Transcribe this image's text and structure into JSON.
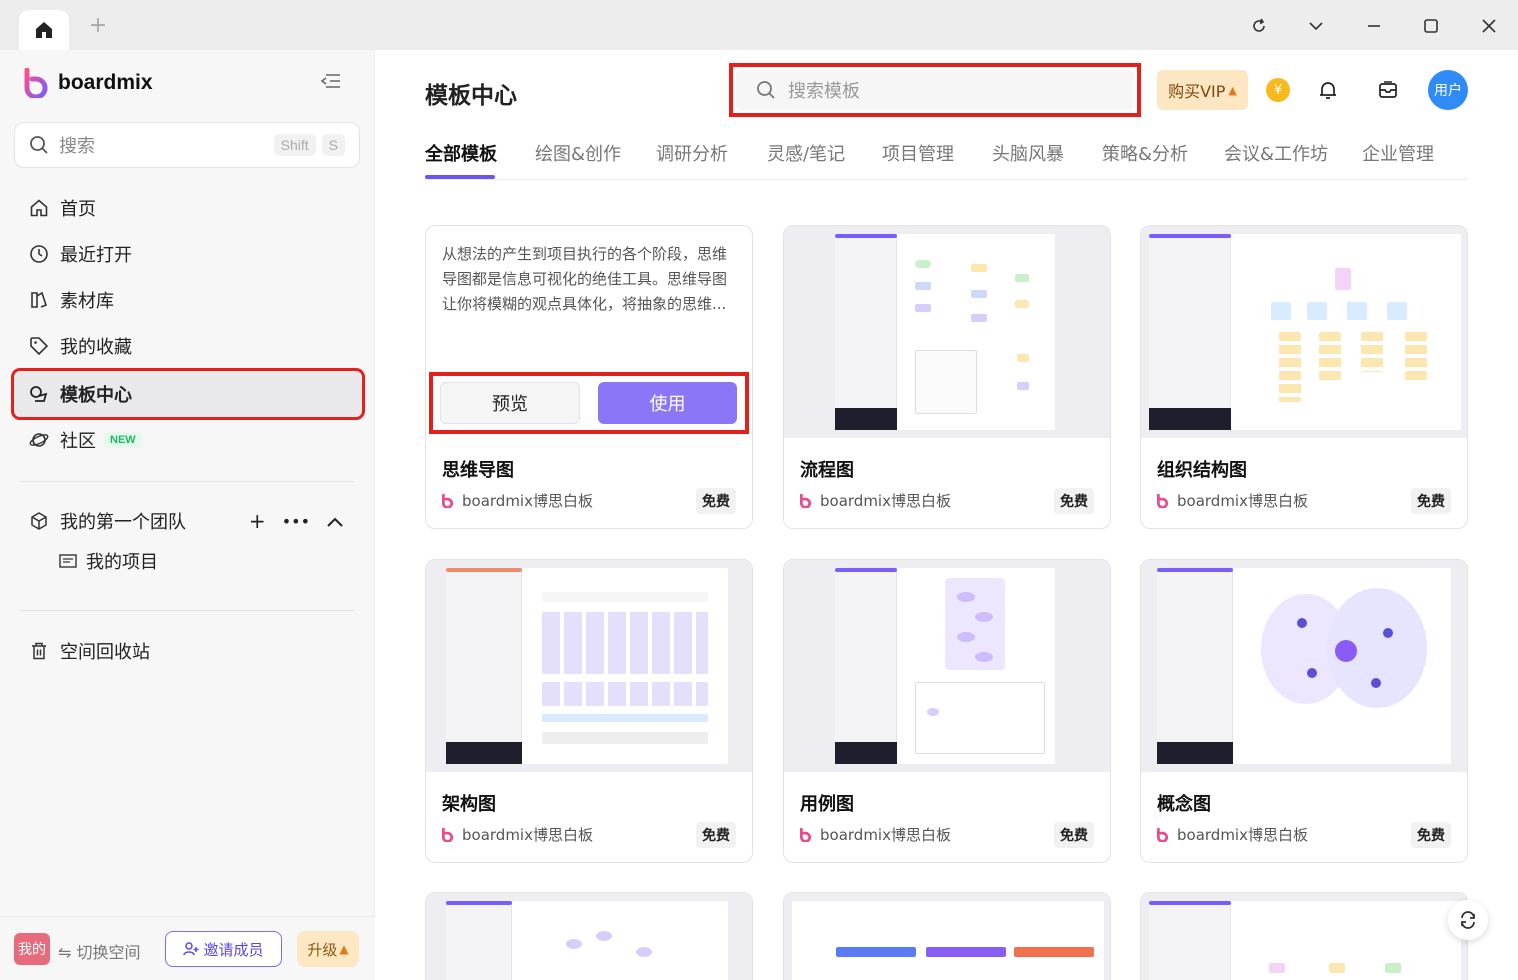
{
  "app": {
    "name": "boardmix"
  },
  "sidebar": {
    "search_placeholder": "搜索",
    "shortcut": [
      "Shift",
      "S"
    ],
    "nav": [
      {
        "label": "首页",
        "icon": "home-icon"
      },
      {
        "label": "最近打开",
        "icon": "clock-icon"
      },
      {
        "label": "素材库",
        "icon": "library-icon"
      },
      {
        "label": "我的收藏",
        "icon": "tag-icon"
      },
      {
        "label": "模板中心",
        "icon": "template-icon"
      },
      {
        "label": "社区",
        "icon": "planet-icon",
        "badge": "NEW"
      }
    ],
    "team": {
      "name": "我的第一个团队"
    },
    "project": "我的项目",
    "trash": "空间回收站",
    "bottom": {
      "avatar": "我的",
      "switch": "⇋ 切换空间",
      "invite": "邀请成员",
      "upgrade": "升级"
    }
  },
  "header": {
    "title": "模板中心",
    "search_placeholder": "搜索模板",
    "vip": "购买VIP",
    "avatar": "用户"
  },
  "tabs": [
    "全部模板",
    "绘图&创作",
    "调研分析",
    "灵感/笔记",
    "项目管理",
    "头脑风暴",
    "策略&分析",
    "会议&工作坊",
    "企业管理"
  ],
  "hover_card": {
    "description": "从想法的产生到项目执行的各个阶段，思维导图都是信息可视化的绝佳工具。思维导图让你将模糊的观点具体化，将抽象的思维...",
    "preview": "预览",
    "use": "使用"
  },
  "cards": [
    {
      "title": "思维导图",
      "author": "boardmix博思白板",
      "price": "免费"
    },
    {
      "title": "流程图",
      "author": "boardmix博思白板",
      "price": "免费"
    },
    {
      "title": "组织结构图",
      "author": "boardmix博思白板",
      "price": "免费"
    },
    {
      "title": "架构图",
      "author": "boardmix博思白板",
      "price": "免费"
    },
    {
      "title": "用例图",
      "author": "boardmix博思白板",
      "price": "免费"
    },
    {
      "title": "概念图",
      "author": "boardmix博思白板",
      "price": "免费"
    }
  ],
  "colors": {
    "accent": "#6b55f0",
    "use_button": "#8b76f7",
    "highlight": "#e3201b"
  }
}
